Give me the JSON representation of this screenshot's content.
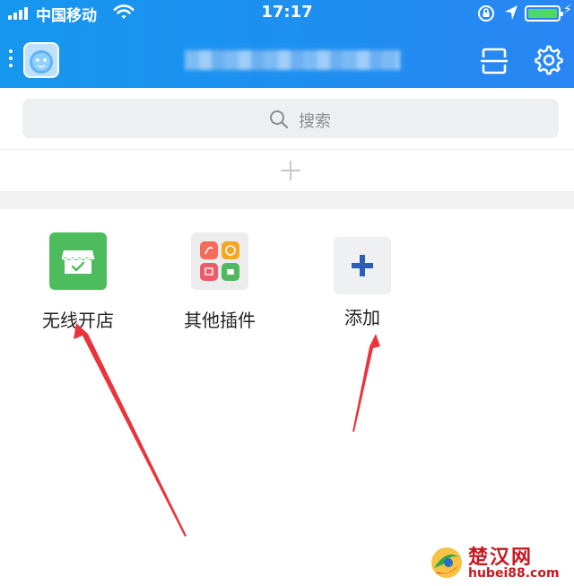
{
  "status_bar": {
    "carrier": "中国移动",
    "time": "17:17",
    "battery_level": 1.0
  },
  "nav": {
    "title": "",
    "icons": [
      "menu-dots-icon",
      "avatar",
      "scan-icon",
      "gear-icon"
    ]
  },
  "search": {
    "placeholder": "搜索"
  },
  "add_bar": {
    "icon": "plus-icon"
  },
  "apps": [
    {
      "label": "无线开店",
      "icon": "store-icon",
      "color": "#4cbc5c"
    },
    {
      "label": "其他插件",
      "icon": "plugin-grid-icon",
      "color": "#ececec"
    },
    {
      "label": "添加",
      "icon": "plus-icon",
      "color": "#2b5eb9"
    }
  ],
  "annotations": {
    "arrow_color": "#e8343a"
  },
  "watermark": {
    "name": "楚汉网",
    "url": "hubei88.com",
    "color": "#c8171f"
  },
  "colors": {
    "header": "#1e8ff0",
    "search_bg": "#eeeff1"
  }
}
